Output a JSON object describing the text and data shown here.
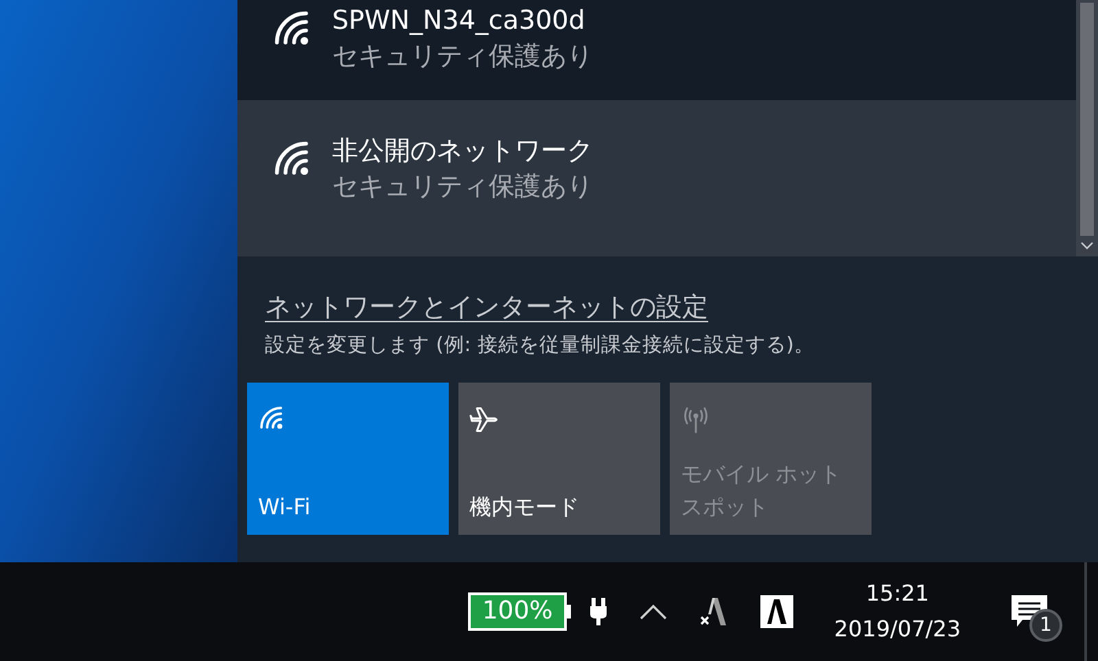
{
  "networks": [
    {
      "name": "SPWN_N34_ca300d",
      "status": "セキュリティ保護あり",
      "selected": false
    },
    {
      "name": "非公開のネットワーク",
      "status": "セキュリティ保護あり",
      "selected": true
    }
  ],
  "settings_link": "ネットワークとインターネットの設定",
  "settings_description": "設定を変更します (例: 接続を従量制課金接続に設定する)。",
  "quick_actions": [
    {
      "kind": "wifi",
      "label": "Wi-Fi",
      "on": true,
      "disabled": false
    },
    {
      "kind": "airplane",
      "label": "機内モード",
      "on": false,
      "disabled": false
    },
    {
      "kind": "hotspot",
      "label": "モバイル ホットスポット",
      "on": false,
      "disabled": true
    }
  ],
  "taskbar": {
    "battery": "100%",
    "time": "15:21",
    "date": "2019/07/23",
    "notification_count": "1"
  }
}
